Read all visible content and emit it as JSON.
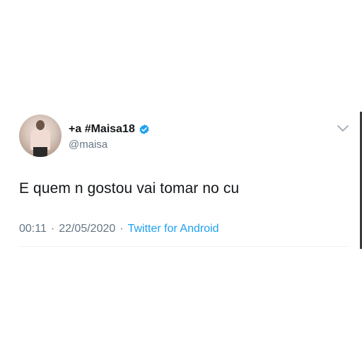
{
  "tweet": {
    "display_name": "+a #Maisa18",
    "handle": "@maisa",
    "text": "E quem n gostou vai tomar no cu",
    "time": "00:11",
    "separator": "·",
    "date": "22/05/2020",
    "source": "Twitter for Android",
    "verified": true,
    "icons": [
      "avatar",
      "verified-badge-icon",
      "chevron-down-icon"
    ]
  },
  "colors": {
    "name": "#14171a",
    "secondary": "#657786",
    "link": "#1da1f2",
    "verified": "#1da1f2"
  }
}
